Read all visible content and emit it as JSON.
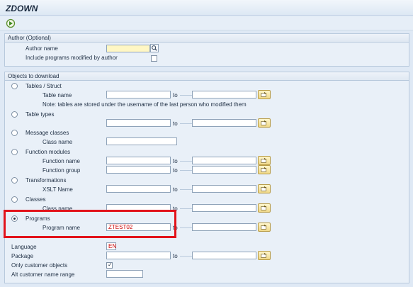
{
  "window": {
    "title": "ZDOWN"
  },
  "toolbar": {
    "execute_icon": "execute-icon"
  },
  "author_group": {
    "title": "Author (Optional)",
    "author_name_label": "Author name",
    "author_name_value": "",
    "include_label": "Include programs modified by author",
    "include_checked": false
  },
  "objects_group": {
    "title": "Objects to download",
    "to_label": "to",
    "options": [
      {
        "key": "tables",
        "label": "Tables / Struct",
        "selected": false
      },
      {
        "key": "types",
        "label": "Table types",
        "selected": false
      },
      {
        "key": "messages",
        "label": "Message classes",
        "selected": false
      },
      {
        "key": "functions",
        "label": "Function modules",
        "selected": false
      },
      {
        "key": "transformations",
        "label": "Transformations",
        "selected": false
      },
      {
        "key": "classes",
        "label": "Classes",
        "selected": false
      },
      {
        "key": "programs",
        "label": "Programs",
        "selected": true
      }
    ],
    "table_name_label": "Table name",
    "note": "Note: tables are stored under the username of the last person who modified them",
    "class_name_label_1": "Class name",
    "function_name_label": "Function name",
    "function_group_label": "Function group",
    "xslt_name_label": "XSLT Name",
    "class_name_label_2": "Class name",
    "program_name_label": "Program name",
    "program_name_value": "ZTEST02",
    "language_label": "Language",
    "language_value": "EN",
    "package_label": "Package",
    "only_customer_label": "Only customer objects",
    "only_customer_checked": true,
    "alt_customer_label": "Alt customer name range"
  },
  "colors": {
    "highlight": "#e2131b",
    "accent": "#1f2f44"
  }
}
